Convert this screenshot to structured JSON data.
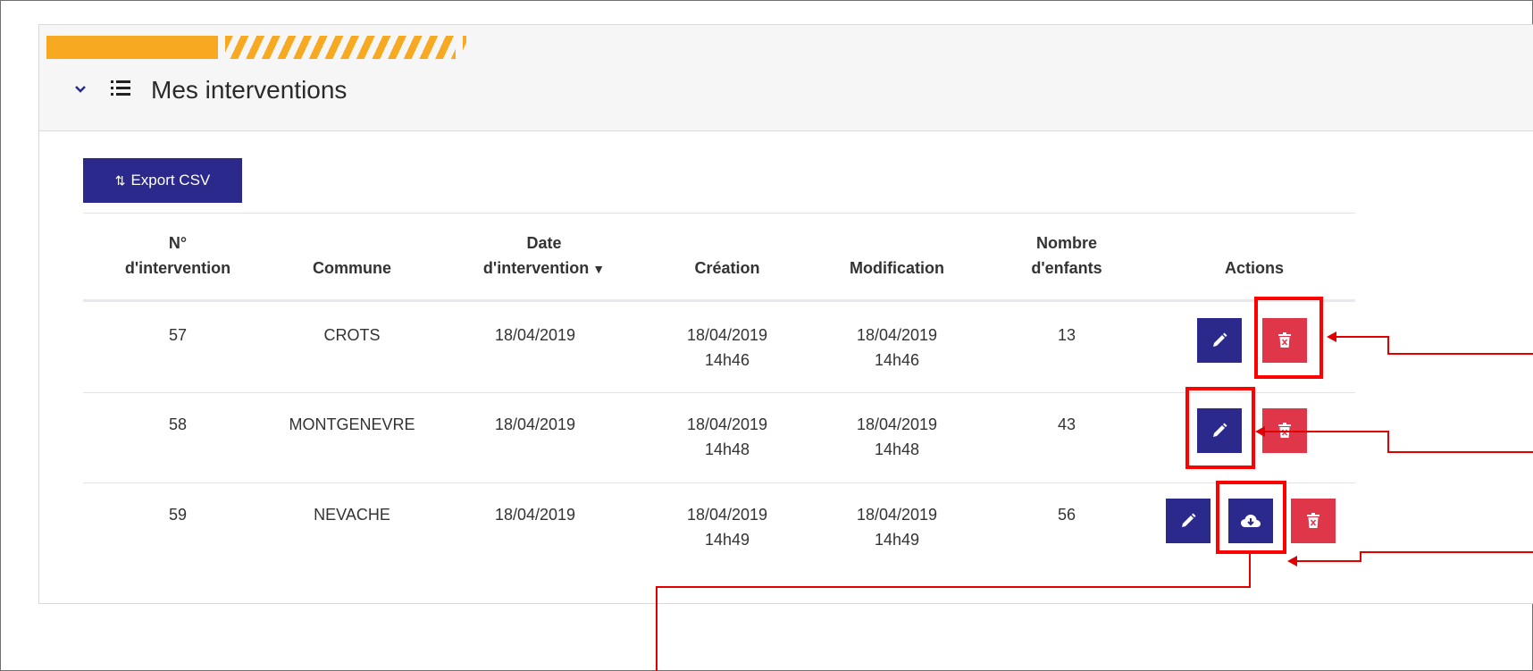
{
  "panel": {
    "title": "Mes interventions"
  },
  "toolbar": {
    "export_label": "Export CSV"
  },
  "table": {
    "columns": [
      {
        "line1": "N°",
        "line2": "d'intervention"
      },
      {
        "line1": "",
        "line2": "Commune"
      },
      {
        "line1": "Date",
        "line2": "d'intervention"
      },
      {
        "line1": "",
        "line2": "Création"
      },
      {
        "line1": "",
        "line2": "Modification"
      },
      {
        "line1": "Nombre",
        "line2": "d'enfants"
      },
      {
        "line1": "",
        "line2": "Actions"
      }
    ],
    "sort": {
      "column": "Date d'intervention",
      "direction": "desc"
    },
    "rows": [
      {
        "num": "57",
        "commune": "CROTS",
        "date": "18/04/2019",
        "creation_date": "18/04/2019",
        "creation_time": "14h46",
        "modif_date": "18/04/2019",
        "modif_time": "14h46",
        "enfants": "13",
        "actions": [
          "edit-icon",
          "trash-icon"
        ]
      },
      {
        "num": "58",
        "commune": "MONTGENEVRE",
        "date": "18/04/2019",
        "creation_date": "18/04/2019",
        "creation_time": "14h48",
        "modif_date": "18/04/2019",
        "modif_time": "14h48",
        "enfants": "43",
        "actions": [
          "edit-icon",
          "trash-icon"
        ]
      },
      {
        "num": "59",
        "commune": "NEVACHE",
        "date": "18/04/2019",
        "creation_date": "18/04/2019",
        "creation_time": "14h49",
        "modif_date": "18/04/2019",
        "modif_time": "14h49",
        "enfants": "56",
        "actions": [
          "edit-icon",
          "cloud-download-icon",
          "trash-icon"
        ]
      }
    ]
  },
  "colors": {
    "primary": "#2b2a8c",
    "danger": "#e0364a",
    "accent": "#f7a921",
    "annotation": "#ff0000"
  }
}
